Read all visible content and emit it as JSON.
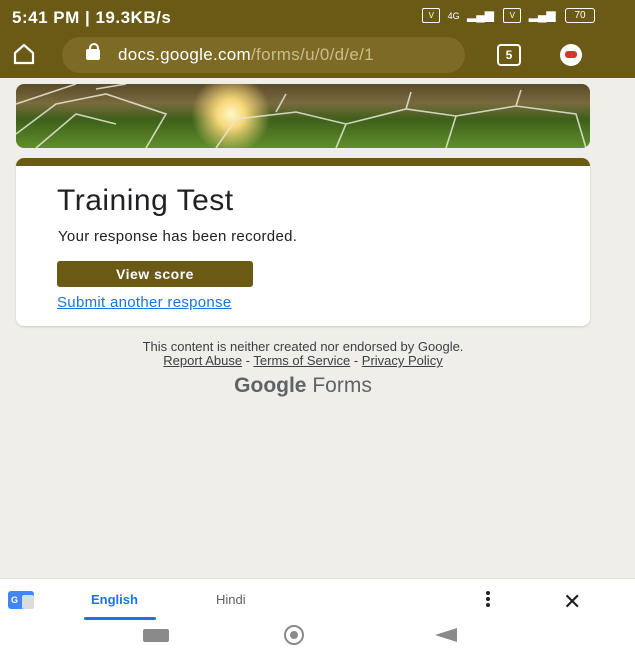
{
  "status_bar": {
    "time_speed": "5:41 PM | 19.3KB/s",
    "network_1": "4G",
    "battery": "70"
  },
  "browser": {
    "url_host": "docs.google.com",
    "url_path": "/forms/u/0/d/e/1",
    "tab_count": "5"
  },
  "form": {
    "title": "Training Test",
    "confirmation": "Your response has been recorded.",
    "view_score_label": "View score",
    "submit_another_label": "Submit another response",
    "disclaimer": "This content is neither created nor endorsed by Google.",
    "report_abuse": "Report Abuse",
    "separator": " - ",
    "terms": "Terms of Service",
    "privacy": "Privacy Policy",
    "brand_google": "Google",
    "brand_forms": "Forms"
  },
  "translate_bar": {
    "icon_text": "G",
    "lang_selected": "English",
    "lang_other": "Hindi"
  },
  "colors": {
    "theme": "#6b5a16",
    "link": "#1a73e8",
    "page_bg": "#efeee9"
  }
}
